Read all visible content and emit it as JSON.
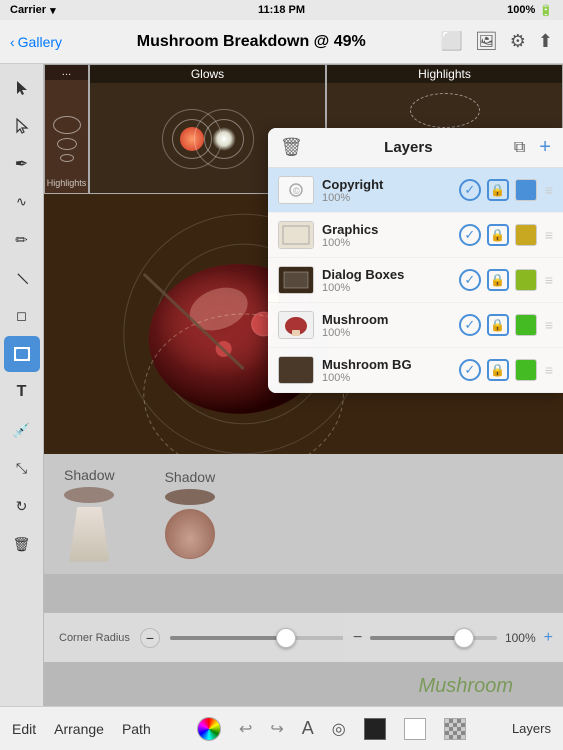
{
  "status_bar": {
    "carrier": "Carrier",
    "wifi_icon": "wifi",
    "time": "11:18 PM",
    "battery": "100%"
  },
  "nav_bar": {
    "back_label": "Gallery",
    "title": "Mushroom Breakdown @ 49%",
    "icon_frame": "⬜",
    "icon_image": "🖼",
    "icon_gear": "⚙",
    "icon_share": "⬆"
  },
  "toolbar": {
    "tools": [
      {
        "name": "select",
        "icon": "▲",
        "active": false
      },
      {
        "name": "direct-select",
        "icon": "↗",
        "active": false
      },
      {
        "name": "pen",
        "icon": "✒",
        "active": false
      },
      {
        "name": "curvature",
        "icon": "∿",
        "active": false
      },
      {
        "name": "pencil",
        "icon": "✏",
        "active": false
      },
      {
        "name": "line",
        "icon": "/",
        "active": false
      },
      {
        "name": "eraser",
        "icon": "◻",
        "active": false
      },
      {
        "name": "rectangle",
        "icon": "▭",
        "active": true
      },
      {
        "name": "type",
        "icon": "T",
        "active": false
      },
      {
        "name": "eyedropper",
        "icon": "💉",
        "active": false
      },
      {
        "name": "scale",
        "icon": "⤡",
        "active": false
      },
      {
        "name": "rotate",
        "icon": "↻",
        "active": false
      },
      {
        "name": "trash",
        "icon": "🗑",
        "active": false
      }
    ]
  },
  "canvas": {
    "thumbnails": [
      {
        "label": "Highlights",
        "type": "highlights"
      },
      {
        "label": "Glows",
        "type": "glows"
      },
      {
        "label": "Highlights",
        "type": "highlights2"
      }
    ]
  },
  "layers_panel": {
    "title": "Layers",
    "trash_label": "🗑",
    "duplicate_label": "⧉",
    "add_label": "+",
    "layers": [
      {
        "name": "Copyright",
        "opacity": "100%",
        "color": "#4a90d9",
        "selected": true,
        "bg": "white"
      },
      {
        "name": "Graphics",
        "opacity": "100%",
        "color": "#c8a820",
        "selected": false,
        "bg": "light"
      },
      {
        "name": "Dialog Boxes",
        "opacity": "100%",
        "color": "#8ab820",
        "selected": false,
        "bg": "dark"
      },
      {
        "name": "Mushroom",
        "opacity": "100%",
        "color": "#44bb22",
        "selected": false,
        "bg": "mushroom"
      },
      {
        "name": "Mushroom BG",
        "opacity": "100%",
        "color": "#44bb22",
        "selected": false,
        "bg": "darkbrown"
      }
    ]
  },
  "corner_radius": {
    "label": "Corner Radius"
  },
  "zoom": {
    "value": "100%"
  },
  "bottom_bar": {
    "edit": "Edit",
    "arrange": "Arrange",
    "path": "Path",
    "layers": "Layers"
  }
}
